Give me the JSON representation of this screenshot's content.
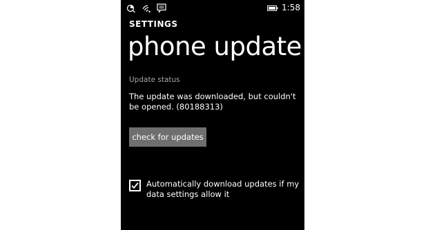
{
  "status_bar": {
    "icons": [
      "data-sense-icon",
      "wifi-icon",
      "message-icon",
      "battery-icon"
    ],
    "time": "1:58"
  },
  "header": {
    "section": "SETTINGS",
    "title": "phone update"
  },
  "update_status": {
    "label": "Update status",
    "message": "The update was downloaded, but couldn't be opened. (80188313)"
  },
  "check_button": {
    "label": "check for updates"
  },
  "auto_download": {
    "checked": true,
    "label": "Automatically download updates if my data settings allow it"
  },
  "colors": {
    "background": "#000000",
    "text": "#ffffff",
    "secondary_text": "#a6a6a6",
    "button": "#6f6f6f"
  }
}
